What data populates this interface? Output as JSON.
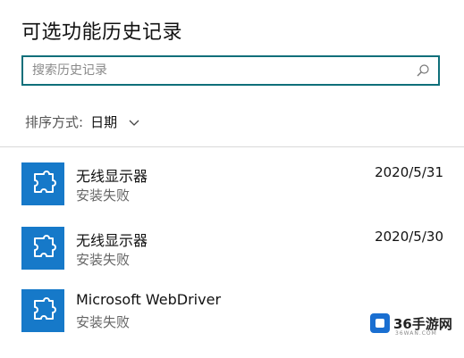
{
  "header": {
    "title": "可选功能历史记录"
  },
  "search": {
    "placeholder": "搜索历史记录",
    "value": ""
  },
  "sort": {
    "label": "排序方式:",
    "value": "日期"
  },
  "history": [
    {
      "name": "无线显示器",
      "status": "安装失败",
      "date": "2020/5/31",
      "icon": "puzzle-icon"
    },
    {
      "name": "无线显示器",
      "status": "安装失败",
      "date": "2020/5/30",
      "icon": "puzzle-icon"
    },
    {
      "name": "Microsoft WebDriver",
      "status": "安装失败",
      "date": "",
      "icon": "puzzle-icon"
    }
  ],
  "watermark": {
    "text": "36手游网",
    "sub": "36WAN.COM"
  },
  "colors": {
    "accent": "#0f6f7a",
    "icon_bg": "#1679c9"
  }
}
